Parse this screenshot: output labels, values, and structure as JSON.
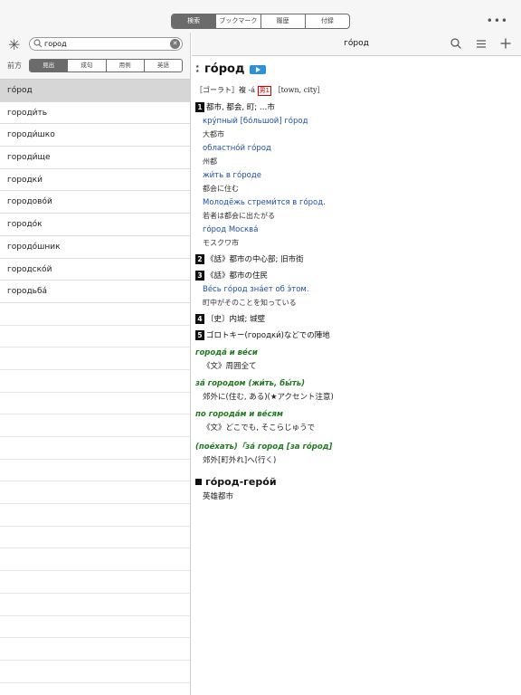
{
  "top_tabs": [
    "検索",
    "ブックマーク",
    "履歴",
    "付録"
  ],
  "top_tab_active": 0,
  "more_label": "•••",
  "search": {
    "value": "город",
    "mode_label": "前方",
    "modes": [
      "見出",
      "成句",
      "用例",
      "英語"
    ],
    "mode_active": 0
  },
  "results": [
    "го́род",
    "городи́ть",
    "городи́шко",
    "городи́ще",
    "городки́",
    "городово́й",
    "городо́к",
    "городо́шник",
    "городско́й",
    "городьба́"
  ],
  "selected_result": 0,
  "entry": {
    "header_title": "го́род",
    "headword": "го́род",
    "info_line": {
      "pre": "［ゴーラト］複 -á",
      "gender": "男1",
      "post": "［town, city］"
    },
    "senses": [
      {
        "num": "1",
        "text": "都市, 都会, 町; …市",
        "examples": [
          {
            "ru": "кру́пный [бо́льшой] го́род",
            "ja": "大都市"
          },
          {
            "ru": "областно́й го́род",
            "ja": "州都"
          },
          {
            "ru": "жи́ть в го́роде",
            "ja": "都会に住む"
          },
          {
            "ru": "Молодёжь стреми́тся в го́род.",
            "ja": "若者は都会に出たがる"
          },
          {
            "ru": "го́род Москва́",
            "ja": "モスクワ市"
          }
        ]
      },
      {
        "num": "2",
        "text": "《話》都市の中心部; 旧市街",
        "examples": []
      },
      {
        "num": "3",
        "text": "《話》都市の住民",
        "examples": [
          {
            "ru": "Ве́сь го́род зна́ет об э́том.",
            "ja": "町中がそのことを知っている"
          }
        ]
      },
      {
        "num": "4",
        "text": "〔史〕内城; 城壁",
        "examples": []
      },
      {
        "num": "5",
        "text": "ゴロトキー(городки́)などでの陣地",
        "examples": []
      }
    ],
    "idioms": [
      {
        "phrase": "города́ и ве́си",
        "def": "《文》周囲全て"
      },
      {
        "phrase": "за́ городом (жи́ть, бы́ть)",
        "def": "郊外に(住む, ある)(★アクセント注意)"
      },
      {
        "phrase": "по города́м и ве́сям",
        "def": "《文》どこでも, そこらじゅうで"
      },
      {
        "phrase": "(поéхать)「за́ город [за го́род]",
        "def": "郊外[町外れ]へ(行く)"
      }
    ],
    "compound": {
      "word": "го́род-геро́й",
      "def": "英雄都市"
    }
  },
  "colors": {
    "accent_blue": "#1d4fa8",
    "idiom_green": "#1f7a1f",
    "gender_red": "#d40000",
    "audio_blue": "#2f8fd8"
  }
}
